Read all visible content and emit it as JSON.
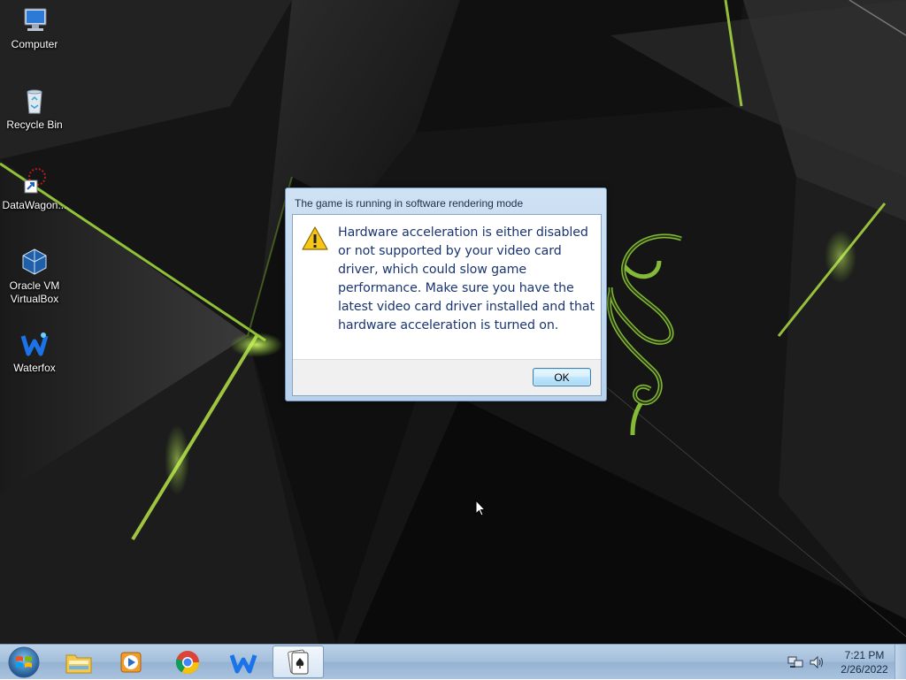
{
  "desktop": {
    "icons": [
      {
        "label": "Computer",
        "icon": "computer-icon"
      },
      {
        "label": "Recycle Bin",
        "icon": "recycle-bin-icon"
      },
      {
        "label": "DataWagon...",
        "icon": "datawagon-icon"
      },
      {
        "label": "Oracle VM VirtualBox",
        "icon": "virtualbox-icon"
      },
      {
        "label": "Waterfox",
        "icon": "waterfox-icon"
      }
    ]
  },
  "dialog": {
    "title": "The game is running in software rendering mode",
    "icon": "warning-icon",
    "message": "Hardware acceleration is either disabled or not supported by your video card driver, which could slow game performance. Make sure you have the latest video card driver installed and that hardware acceleration is turned on.",
    "ok_label": "OK"
  },
  "taskbar": {
    "start": "windows-start-icon",
    "items": [
      {
        "name": "file-explorer",
        "icon": "folder-icon"
      },
      {
        "name": "media-player",
        "icon": "media-player-icon"
      },
      {
        "name": "chrome",
        "icon": "chrome-icon"
      },
      {
        "name": "waterfox",
        "icon": "waterfox-icon"
      },
      {
        "name": "solitaire",
        "icon": "solitaire-icon",
        "active": true
      }
    ],
    "tray": {
      "network": "network-icon",
      "volume": "volume-icon",
      "time": "7:21 PM",
      "date": "2/26/2022"
    }
  },
  "colors": {
    "accent_green": "#9be03a",
    "dialog_text": "#1a3570",
    "taskbar": "#a3bedb"
  }
}
